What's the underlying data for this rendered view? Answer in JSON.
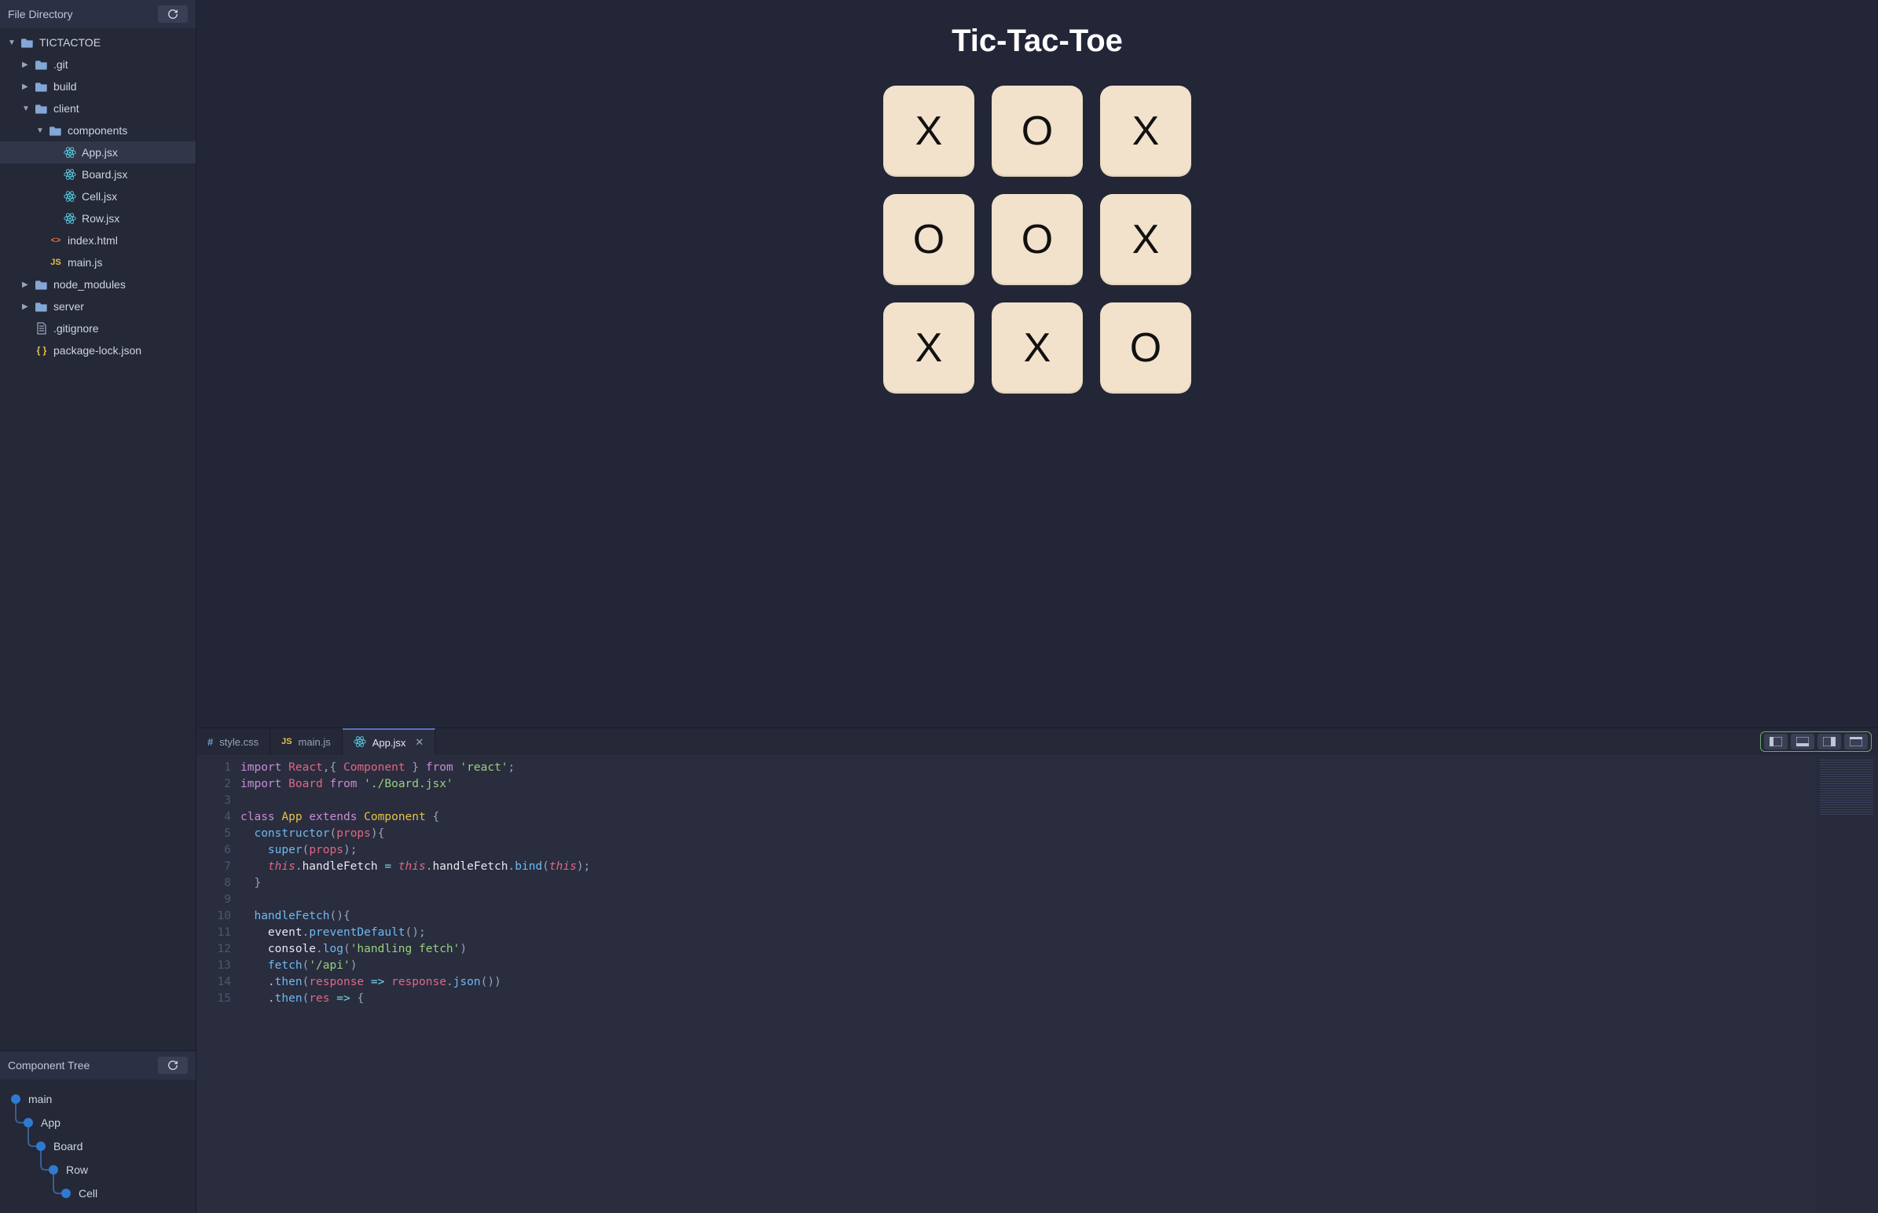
{
  "sidebar": {
    "file_directory_title": "File Directory",
    "component_tree_title": "Component Tree",
    "refresh_icon": "refresh-icon",
    "tree": [
      {
        "label": "TICTACTOE",
        "type": "folder",
        "open": true,
        "depth": 0
      },
      {
        "label": ".git",
        "type": "folder",
        "open": false,
        "depth": 1
      },
      {
        "label": "build",
        "type": "folder",
        "open": false,
        "depth": 1
      },
      {
        "label": "client",
        "type": "folder",
        "open": true,
        "depth": 1
      },
      {
        "label": "components",
        "type": "folder",
        "open": true,
        "depth": 2
      },
      {
        "label": "App.jsx",
        "type": "react",
        "depth": 3,
        "selected": true
      },
      {
        "label": "Board.jsx",
        "type": "react",
        "depth": 3
      },
      {
        "label": "Cell.jsx",
        "type": "react",
        "depth": 3
      },
      {
        "label": "Row.jsx",
        "type": "react",
        "depth": 3
      },
      {
        "label": "index.html",
        "type": "html",
        "depth": 2
      },
      {
        "label": "main.js",
        "type": "js",
        "depth": 2
      },
      {
        "label": "node_modules",
        "type": "folder",
        "open": false,
        "depth": 1
      },
      {
        "label": "server",
        "type": "folder",
        "open": false,
        "depth": 1
      },
      {
        "label": ".gitignore",
        "type": "file",
        "depth": 1
      },
      {
        "label": "package-lock.json",
        "type": "json",
        "depth": 1
      }
    ],
    "component_tree": [
      {
        "label": "main",
        "depth": 0
      },
      {
        "label": "App",
        "depth": 1
      },
      {
        "label": "Board",
        "depth": 2
      },
      {
        "label": "Row",
        "depth": 3
      },
      {
        "label": "Cell",
        "depth": 4
      }
    ]
  },
  "preview": {
    "title": "Tic-Tac-Toe",
    "cells": [
      "X",
      "O",
      "X",
      "O",
      "O",
      "X",
      "X",
      "X",
      "O"
    ]
  },
  "editor": {
    "tabs": [
      {
        "label": "style.css",
        "icon": "hash",
        "active": false
      },
      {
        "label": "main.js",
        "icon": "js",
        "active": false
      },
      {
        "label": "App.jsx",
        "icon": "react",
        "active": true,
        "closeable": true
      }
    ],
    "line_start": 1,
    "line_end": 15,
    "code_lines": [
      [
        {
          "t": "kw",
          "s": "import"
        },
        {
          "t": "p",
          "s": " "
        },
        {
          "t": "var",
          "s": "React"
        },
        {
          "t": "punc",
          "s": ",{ "
        },
        {
          "t": "var",
          "s": "Component"
        },
        {
          "t": "punc",
          "s": " } "
        },
        {
          "t": "kw",
          "s": "from"
        },
        {
          "t": "p",
          "s": " "
        },
        {
          "t": "str",
          "s": "'react'"
        },
        {
          "t": "punc",
          "s": ";"
        }
      ],
      [
        {
          "t": "kw",
          "s": "import"
        },
        {
          "t": "p",
          "s": " "
        },
        {
          "t": "var",
          "s": "Board"
        },
        {
          "t": "p",
          "s": " "
        },
        {
          "t": "kw",
          "s": "from"
        },
        {
          "t": "p",
          "s": " "
        },
        {
          "t": "str",
          "s": "'./Board.jsx'"
        }
      ],
      [],
      [
        {
          "t": "kw",
          "s": "class"
        },
        {
          "t": "p",
          "s": " "
        },
        {
          "t": "type",
          "s": "App"
        },
        {
          "t": "p",
          "s": " "
        },
        {
          "t": "kw",
          "s": "extends"
        },
        {
          "t": "p",
          "s": " "
        },
        {
          "t": "type",
          "s": "Component"
        },
        {
          "t": "p",
          "s": " "
        },
        {
          "t": "punc",
          "s": "{"
        }
      ],
      [
        {
          "t": "p",
          "s": "  "
        },
        {
          "t": "fn",
          "s": "constructor"
        },
        {
          "t": "punc",
          "s": "("
        },
        {
          "t": "var",
          "s": "props"
        },
        {
          "t": "punc",
          "s": "){"
        }
      ],
      [
        {
          "t": "p",
          "s": "    "
        },
        {
          "t": "fn",
          "s": "super"
        },
        {
          "t": "punc",
          "s": "("
        },
        {
          "t": "var",
          "s": "props"
        },
        {
          "t": "punc",
          "s": ");"
        }
      ],
      [
        {
          "t": "p",
          "s": "    "
        },
        {
          "t": "this",
          "s": "this"
        },
        {
          "t": "punc",
          "s": "."
        },
        {
          "t": "attr",
          "s": "handleFetch"
        },
        {
          "t": "p",
          "s": " "
        },
        {
          "t": "op",
          "s": "="
        },
        {
          "t": "p",
          "s": " "
        },
        {
          "t": "this",
          "s": "this"
        },
        {
          "t": "punc",
          "s": "."
        },
        {
          "t": "attr",
          "s": "handleFetch"
        },
        {
          "t": "punc",
          "s": "."
        },
        {
          "t": "fn",
          "s": "bind"
        },
        {
          "t": "punc",
          "s": "("
        },
        {
          "t": "this",
          "s": "this"
        },
        {
          "t": "punc",
          "s": ");"
        }
      ],
      [
        {
          "t": "p",
          "s": "  "
        },
        {
          "t": "punc",
          "s": "}"
        }
      ],
      [],
      [
        {
          "t": "p",
          "s": "  "
        },
        {
          "t": "fn",
          "s": "handleFetch"
        },
        {
          "t": "punc",
          "s": "(){"
        }
      ],
      [
        {
          "t": "p",
          "s": "    "
        },
        {
          "t": "attr",
          "s": "event"
        },
        {
          "t": "punc",
          "s": "."
        },
        {
          "t": "fn",
          "s": "preventDefault"
        },
        {
          "t": "punc",
          "s": "();"
        }
      ],
      [
        {
          "t": "p",
          "s": "    "
        },
        {
          "t": "attr",
          "s": "console"
        },
        {
          "t": "punc",
          "s": "."
        },
        {
          "t": "fn",
          "s": "log"
        },
        {
          "t": "punc",
          "s": "("
        },
        {
          "t": "str",
          "s": "'handling fetch'"
        },
        {
          "t": "punc",
          "s": ")"
        }
      ],
      [
        {
          "t": "p",
          "s": "    "
        },
        {
          "t": "fn",
          "s": "fetch"
        },
        {
          "t": "punc",
          "s": "("
        },
        {
          "t": "str",
          "s": "'/api'"
        },
        {
          "t": "punc",
          "s": ")"
        }
      ],
      [
        {
          "t": "p",
          "s": "    ."
        },
        {
          "t": "fn",
          "s": "then"
        },
        {
          "t": "punc",
          "s": "("
        },
        {
          "t": "var",
          "s": "response"
        },
        {
          "t": "p",
          "s": " "
        },
        {
          "t": "op",
          "s": "=>"
        },
        {
          "t": "p",
          "s": " "
        },
        {
          "t": "var",
          "s": "response"
        },
        {
          "t": "punc",
          "s": "."
        },
        {
          "t": "fn",
          "s": "json"
        },
        {
          "t": "punc",
          "s": "())"
        }
      ],
      [
        {
          "t": "p",
          "s": "    ."
        },
        {
          "t": "fn",
          "s": "then"
        },
        {
          "t": "punc",
          "s": "("
        },
        {
          "t": "var",
          "s": "res"
        },
        {
          "t": "p",
          "s": " "
        },
        {
          "t": "op",
          "s": "=>"
        },
        {
          "t": "p",
          "s": " "
        },
        {
          "t": "punc",
          "s": "{"
        }
      ]
    ]
  }
}
